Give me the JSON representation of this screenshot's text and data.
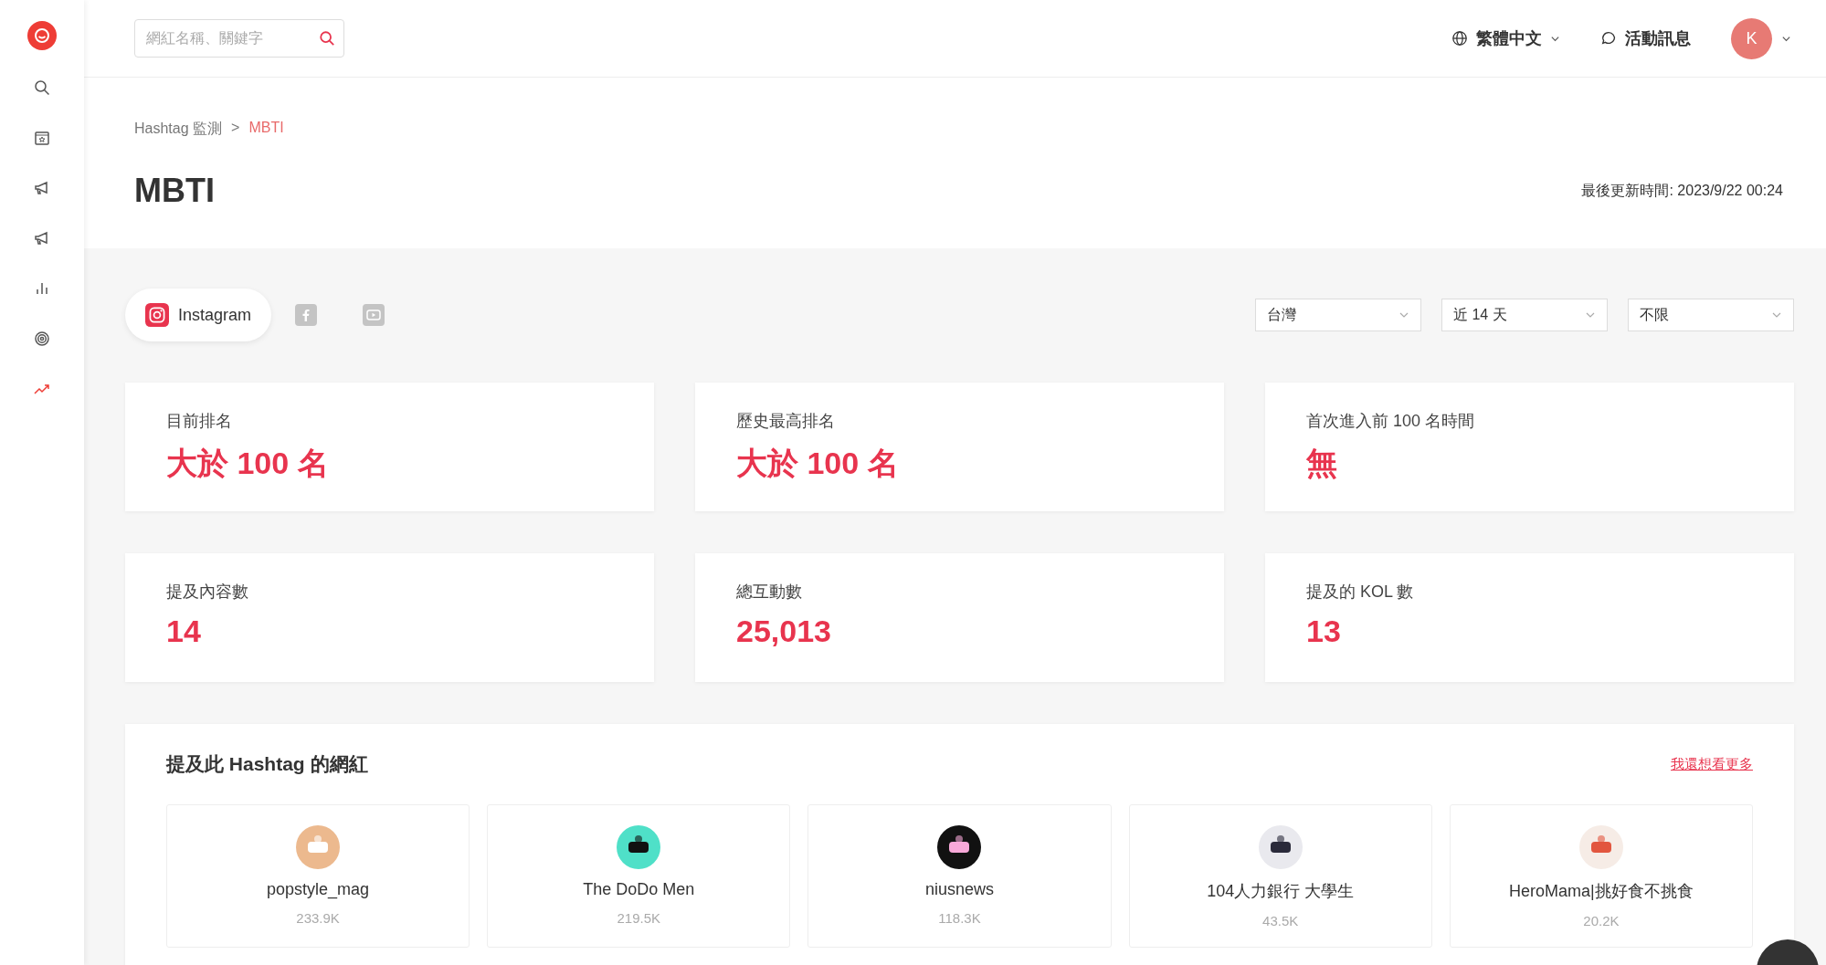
{
  "sidebar": {
    "items": [
      {
        "kind": "search",
        "selected": false
      },
      {
        "kind": "calendar",
        "selected": false
      },
      {
        "kind": "megaphone",
        "selected": false
      },
      {
        "kind": "megaphone",
        "selected": false
      },
      {
        "kind": "chart",
        "selected": false
      },
      {
        "kind": "target",
        "selected": false
      },
      {
        "kind": "trend",
        "selected": true
      }
    ]
  },
  "header": {
    "search": {
      "placeholder": "網紅名稱、關鍵字"
    },
    "language": "繁體中文",
    "activity": "活動訊息",
    "avatar": "K"
  },
  "breadcrumb": [
    {
      "label": "Hashtag 監測",
      "current": false
    },
    {
      "label": ">",
      "current": false
    },
    {
      "label": "MBTI",
      "current": true
    }
  ],
  "title": "MBTI",
  "updated": "最後更新時間: 2023/9/22 00:24",
  "platforms": [
    {
      "kind": "instagram",
      "label": "Instagram",
      "selected": true
    },
    {
      "kind": "facebook",
      "selected": false
    },
    {
      "kind": "youtube",
      "selected": false
    }
  ],
  "filters": [
    {
      "value": "台灣"
    },
    {
      "value": "近 14 天"
    },
    {
      "value": "不限"
    }
  ],
  "stats": [
    {
      "label": "目前排名",
      "value": "大於 100 名"
    },
    {
      "label": "歷史最高排名",
      "value": "大於 100 名"
    },
    {
      "label": "首次進入前 100 名時間",
      "value": "無"
    },
    {
      "label": "提及內容數",
      "value": "14"
    },
    {
      "label": "總互動數",
      "value": "25,013"
    },
    {
      "label": "提及的 KOL 數",
      "value": "13"
    }
  ],
  "influencers": {
    "title": "提及此 Hashtag 的網紅",
    "more": "我還想看更多",
    "items": [
      {
        "name": "popstyle_mag",
        "followers": "233.9K"
      },
      {
        "name": "The DoDo Men",
        "followers": "219.5K"
      },
      {
        "name": "niusnews",
        "followers": "118.3K"
      },
      {
        "name": "104人力銀行 大學生",
        "followers": "43.5K"
      },
      {
        "name": "HeroMama|挑好食不挑食",
        "followers": "20.2K"
      }
    ]
  }
}
